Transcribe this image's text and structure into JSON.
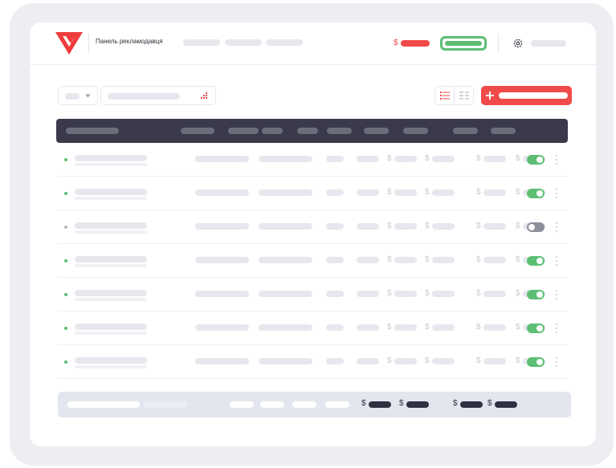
{
  "header": {
    "title": "Панель рекламодавця",
    "balance_currency": "$",
    "icon": "gear-icon",
    "logo": "logo-icon"
  },
  "toolbar": {
    "view_list_icon": "list-view-icon",
    "view_compact_icon": "compact-view-icon",
    "add_icon": "plus-icon",
    "filter_icon": "chevron-down-icon",
    "search_icon": "grid-dots-icon"
  },
  "rows": [
    {
      "active": true
    },
    {
      "active": true
    },
    {
      "active": false
    },
    {
      "active": true
    },
    {
      "active": true
    },
    {
      "active": true
    },
    {
      "active": true
    }
  ],
  "currency": "$",
  "colors": {
    "accent_red": "#f04a4a",
    "accent_green": "#5cbf73",
    "header_dark": "#3a3a4a",
    "inactive_gray": "#8d8f9a"
  }
}
